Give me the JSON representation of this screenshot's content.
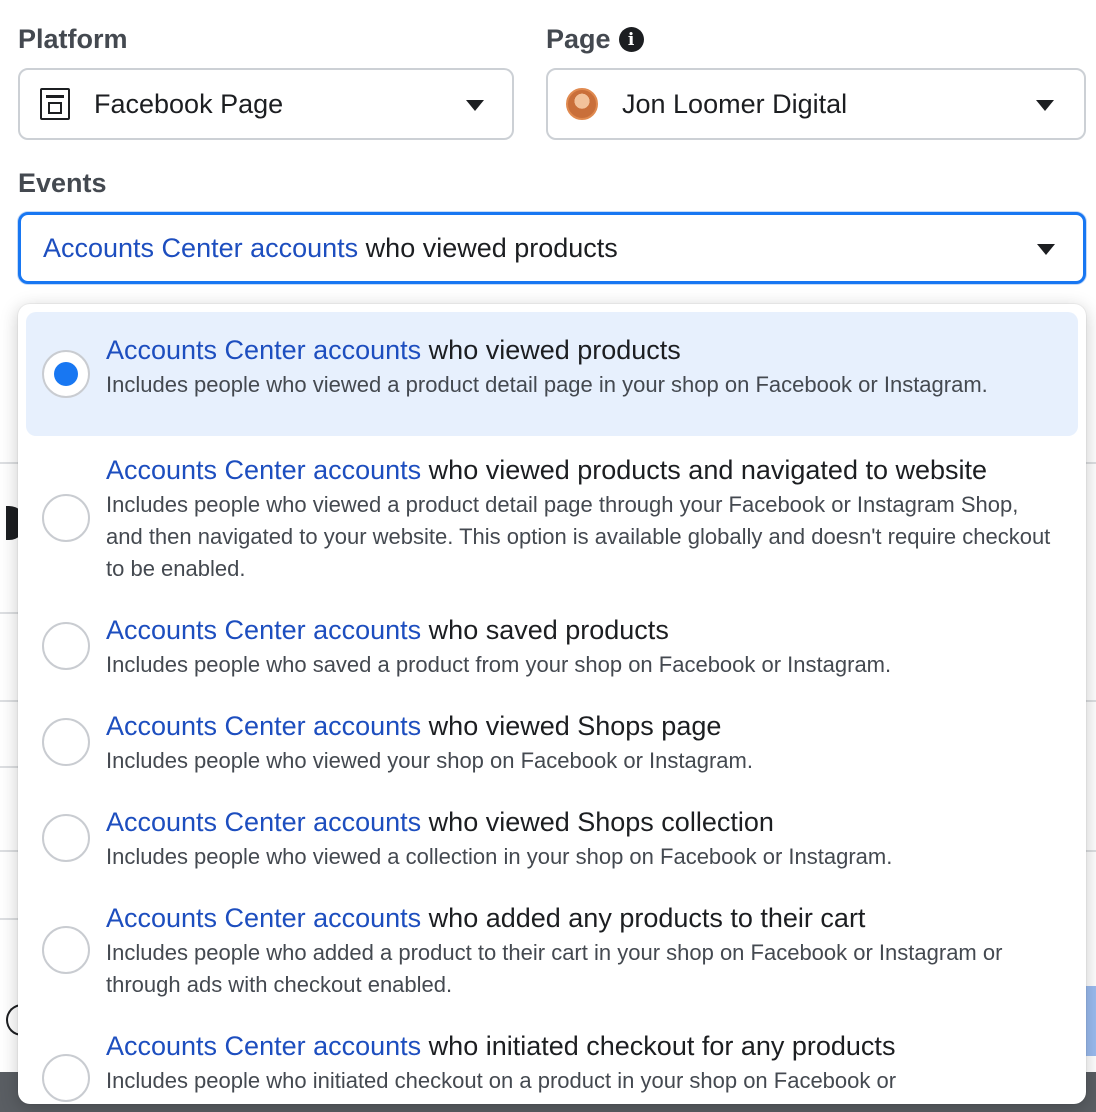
{
  "platform": {
    "label": "Platform",
    "value": "Facebook Page",
    "icon": "page-icon"
  },
  "page": {
    "label": "Page",
    "info_icon": "info-icon",
    "info_glyph": "i",
    "value": "Jon Loomer Digital",
    "avatar": "avatar"
  },
  "events": {
    "label": "Events",
    "selected_prefix": "Accounts Center accounts",
    "selected_suffix": " who viewed products"
  },
  "dropdown": {
    "options": [
      {
        "prefix": "Accounts Center accounts",
        "suffix": " who viewed products",
        "desc": "Includes people who viewed a product detail page in your shop on Facebook or Instagram.",
        "selected": true
      },
      {
        "prefix": "Accounts Center accounts",
        "suffix": " who viewed products and navigated to website",
        "desc": "Includes people who viewed a product detail page through your Facebook or Instagram Shop, and then navigated to your website. This option is available globally and doesn't require checkout to be enabled.",
        "selected": false
      },
      {
        "prefix": "Accounts Center accounts",
        "suffix": " who saved products",
        "desc": "Includes people who saved a product from your shop on Facebook or Instagram.",
        "selected": false
      },
      {
        "prefix": "Accounts Center accounts",
        "suffix": " who viewed Shops page",
        "desc": "Includes people who viewed your shop on Facebook or Instagram.",
        "selected": false
      },
      {
        "prefix": "Accounts Center accounts",
        "suffix": " who viewed Shops collection",
        "desc": "Includes people who viewed a collection in your shop on Facebook or Instagram.",
        "selected": false
      },
      {
        "prefix": "Accounts Center accounts",
        "suffix": " who added any products to their cart",
        "desc": "Includes people who added a product to their cart in your shop on Facebook or Instagram or through ads with checkout enabled.",
        "selected": false
      },
      {
        "prefix": "Accounts Center accounts",
        "suffix": " who initiated checkout for any products",
        "desc": "Includes people who initiated checkout on a product in your shop on Facebook or",
        "selected": false
      }
    ]
  },
  "colors": {
    "accent": "#1877f2",
    "link_blue": "#1d4ebf",
    "selected_bg": "#e7f0fd",
    "border": "#ccd0d5"
  }
}
